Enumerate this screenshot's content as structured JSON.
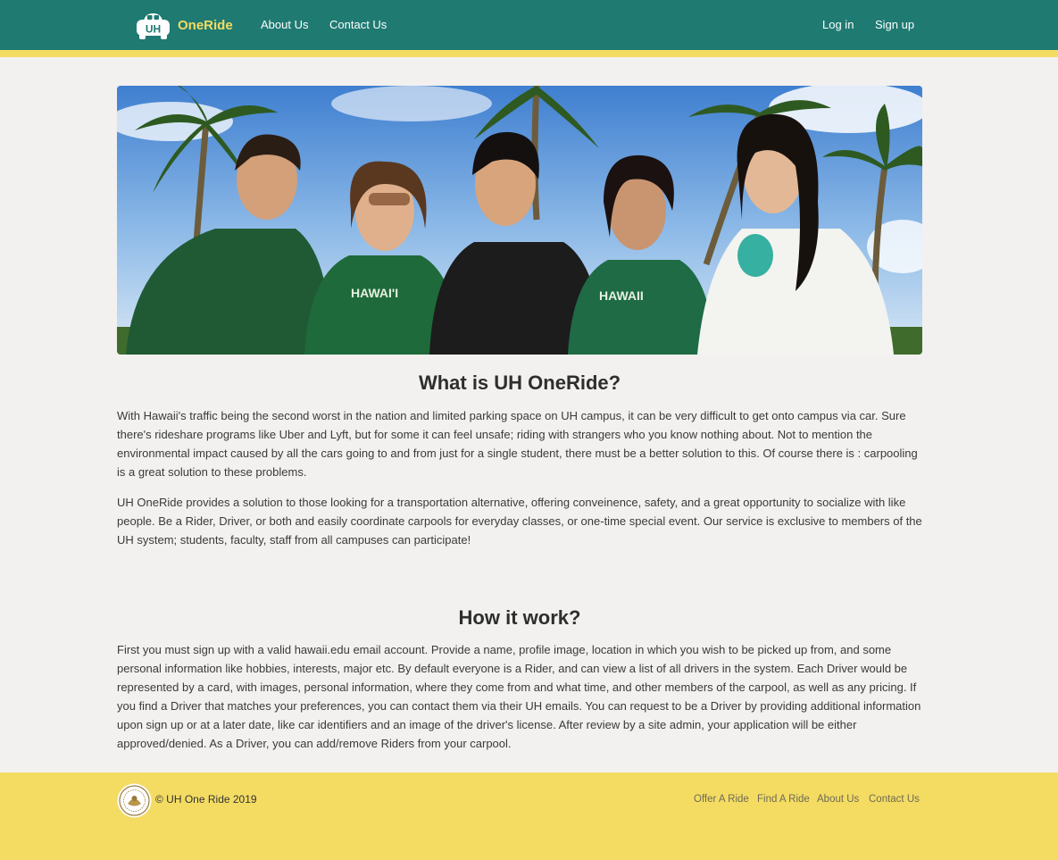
{
  "navbar": {
    "brand_name": "OneRide",
    "logo_text": "UH",
    "links": {
      "about": "About Us",
      "contact": "Contact Us",
      "login": "Log in",
      "signup": "Sign up"
    }
  },
  "colors": {
    "nav_bg": "#1f7a72",
    "accent_yellow": "#f4dc63",
    "page_bg": "#f2f1ef"
  },
  "hero": {
    "image_alt": "Group of smiling students under palm trees",
    "shirt_text_1": "HAWAI'I",
    "shirt_text_2": "HAWAII"
  },
  "sections": {
    "what": {
      "title": "What is UH OneRide?",
      "p1": "With Hawaii's traffic being the second worst in the nation and limited parking space on UH campus, it can be very difficult to get onto campus via car. Sure there's rideshare programs like Uber and Lyft, but for some it can feel unsafe; riding with strangers who you know nothing about. Not to mention the environmental impact caused by all the cars going to and from just for a single student, there must be a better solution to this. Of course there is : carpooling is a great solution to these problems.",
      "p2": "UH OneRide provides a solution to those looking for a transportation alternative, offering conveinence, safety, and a great opportunity to socialize with like people. Be a Rider, Driver, or both and easily coordinate carpools for everyday classes, or one-time special event. Our service is exclusive to members of the UH system; students, faculty, staff from all campuses can participate!"
    },
    "how": {
      "title": "How it work?",
      "p1": "First you must sign up with a valid hawaii.edu email account. Provide a name, profile image, location in which you wish to be picked up from, and some personal information like hobbies, interests, major etc. By default everyone is a Rider, and can view a list of all drivers in the system. Each Driver would be represented by a card, with images, personal information, where they come from and what time, and other members of the carpool, as well as any pricing. If you find a Driver that matches your preferences, you can contact them via their UH emails. You can request to be a Driver by providing additional information upon sign up or at a later date, like car identifiers and an image of the driver's license. After review by a site admin, your application will be either approved/denied. As a Driver, you can add/remove Riders from your carpool."
    }
  },
  "footer": {
    "copyright": "© UH One Ride 2019",
    "links": {
      "offer": "Offer A Ride",
      "find": "Find A Ride",
      "about": "About Us",
      "contact": "Contact Us"
    }
  }
}
